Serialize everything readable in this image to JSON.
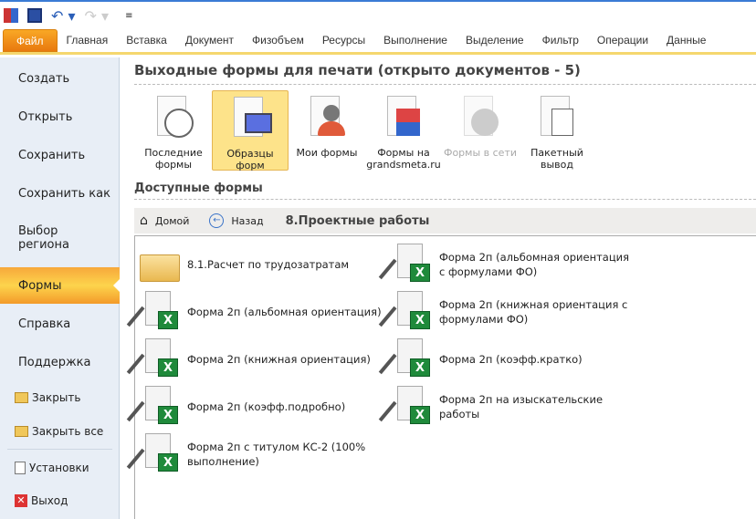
{
  "ribbon": {
    "tabs": [
      "Файл",
      "Главная",
      "Вставка",
      "Документ",
      "Физобъем",
      "Ресурсы",
      "Выполнение",
      "Выделение",
      "Фильтр",
      "Операции",
      "Данные"
    ]
  },
  "sidebar": {
    "items": [
      "Создать",
      "Открыть",
      "Сохранить",
      "Сохранить как",
      "Выбор региона",
      "Формы",
      "Справка",
      "Поддержка"
    ],
    "small": [
      "Закрыть",
      "Закрыть все",
      "Установки",
      "Выход"
    ]
  },
  "main": {
    "title": "Выходные формы для печати (открыто документов - 5)",
    "buttons": [
      "Последние формы",
      "Образцы форм",
      "Мои формы",
      "Формы на grandsmeta.ru",
      "Формы в сети",
      "Пакетный вывод"
    ],
    "section": "Доступные формы",
    "nav": {
      "home": "Домой",
      "back": "Назад",
      "crumb": "8.Проектные работы"
    },
    "items": [
      "8.1.Расчет по трудозатратам",
      "Форма 2п (альбомная ориентация)",
      "Форма 2п (книжная ориентация)",
      "Форма 2п (коэфф.подробно)",
      "Форма 2п с титулом КС-2 (100% выполнение)",
      "Форма 2п (альбомная ориентация с формулами ФО)",
      "Форма 2п (книжная ориентация с формулами ФО)",
      "Форма 2п (коэфф.кратко)",
      "Форма 2п на изыскательские работы"
    ]
  }
}
